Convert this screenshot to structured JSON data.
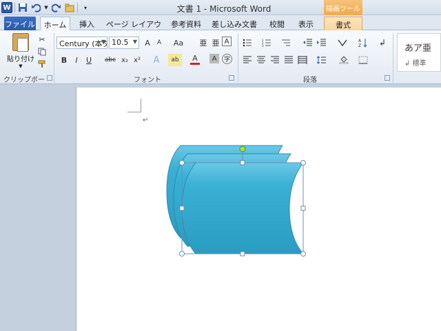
{
  "window": {
    "title": "文書 1 - Microsoft Word",
    "app_icon": "W",
    "contextual_tab_group": "描画ツール"
  },
  "qat": {
    "icons": [
      "save-icon",
      "undo-icon",
      "redo-icon",
      "open-icon",
      "customize-icon"
    ]
  },
  "tabs": [
    {
      "label": "ファイル",
      "state": "file"
    },
    {
      "label": "ホーム",
      "state": "active"
    },
    {
      "label": "挿入",
      "state": "normal"
    },
    {
      "label": "ページ レイアウト",
      "state": "normal"
    },
    {
      "label": "参考資料",
      "state": "normal"
    },
    {
      "label": "差し込み文書",
      "state": "normal"
    },
    {
      "label": "校閲",
      "state": "normal"
    },
    {
      "label": "表示",
      "state": "normal"
    },
    {
      "label": "書式",
      "state": "contextual"
    }
  ],
  "ribbon": {
    "clipboard": {
      "paste_label": "貼り付け",
      "group_label": "クリップボード"
    },
    "font": {
      "font_name": "Century (本ダ",
      "font_size": "10.5",
      "group_label": "フォント",
      "buttons_row1": [
        "A",
        "A",
        "Aa",
        "亜",
        "亜",
        "A"
      ],
      "buttons_row2": [
        "B",
        "I",
        "U",
        "abc",
        "x₂",
        "x²",
        "A",
        "ab",
        "A",
        "A",
        "字"
      ],
      "font_color": "#d62424"
    },
    "paragraph": {
      "group_label": "段落"
    },
    "styles": {
      "sample": "あア亜",
      "name": "↲ 標準"
    }
  },
  "document": {
    "shape": {
      "type": "multi-document flowchart shape",
      "fill": "#33aed0",
      "selection_color": "#6a8cb4",
      "rotation_handle_color": "#a6e23a"
    }
  }
}
